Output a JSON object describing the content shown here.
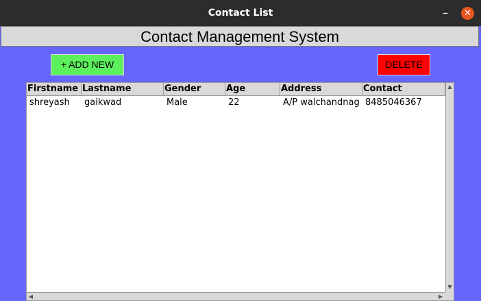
{
  "window": {
    "title": "Contact List",
    "minimize_glyph": "–",
    "close_glyph": "✕"
  },
  "header": {
    "title": "Contact Management System"
  },
  "toolbar": {
    "add_label": "+ ADD NEW",
    "delete_label": "DELETE",
    "add_color": "#5df05d",
    "delete_color": "#ff0000"
  },
  "table": {
    "columns": [
      "Firstname",
      "Lastname",
      "Gender",
      "Age",
      "Address",
      "Contact"
    ],
    "rows": [
      [
        "shreyash",
        "gaikwad",
        "Male",
        "22",
        "A/P walchandnag",
        "8485046367"
      ]
    ]
  },
  "colors": {
    "background": "#6666ff",
    "titlebar": "#2c2c2c"
  }
}
